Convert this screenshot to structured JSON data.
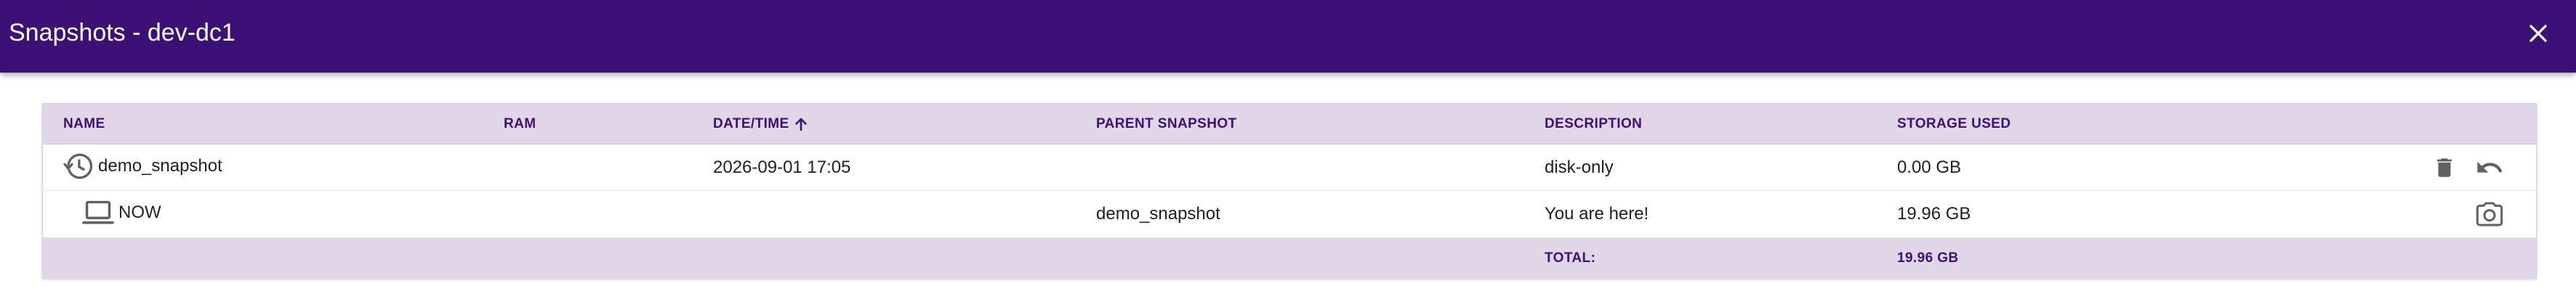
{
  "window": {
    "title": "Snapshots - dev-dc1",
    "close_icon": "close-icon"
  },
  "table": {
    "columns": [
      "NAME",
      "RAM",
      "DATE/TIME",
      "PARENT SNAPSHOT",
      "DESCRIPTION",
      "STORAGE USED"
    ],
    "sort": {
      "column": "DATE/TIME",
      "direction": "ascending",
      "icon": "arrow-up-icon"
    },
    "rows": [
      {
        "icon": "history-icon",
        "name": "demo_snapshot",
        "ram": "",
        "datetime": "2026-09-01 17:05",
        "parent": "",
        "description": "disk-only",
        "storage": "0.00 GB",
        "actions": [
          "delete-icon",
          "undo-icon"
        ]
      },
      {
        "icon": "laptop-icon",
        "name": "NOW",
        "ram": "",
        "datetime": "",
        "parent": "demo_snapshot",
        "description": "You are here!",
        "storage": "19.96 GB",
        "actions": [
          "camera-icon"
        ]
      }
    ],
    "footer": {
      "total_label": "TOTAL:",
      "total_value": "19.96 GB"
    }
  },
  "colors": {
    "header_bg": "#3c1074",
    "table_header_bg": "#e0d6e8",
    "accent_text": "#3c1074",
    "icon_gray": "#616161"
  }
}
